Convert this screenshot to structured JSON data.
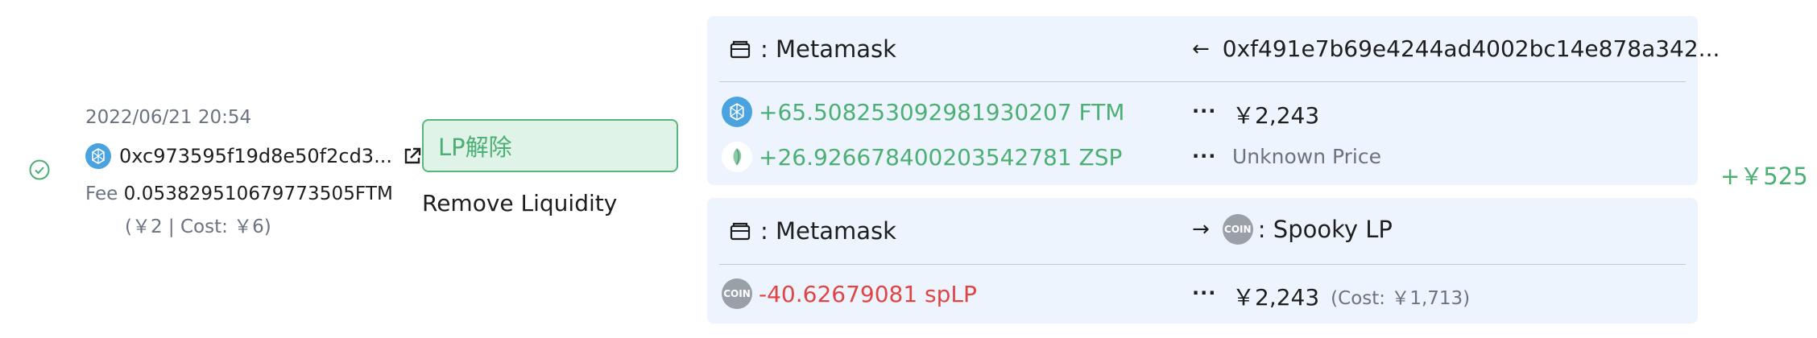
{
  "status": {
    "icon": "check-circle-icon"
  },
  "tx": {
    "date": "2022/06/21 20:54",
    "hash": "0xc973595f19d8e50f2cd3...",
    "fee_label": "Fee",
    "fee_value": "0.053829510679773505FTM",
    "fee_fiat": "(￥2 | Cost: ￥6)"
  },
  "action": {
    "badge": "LP解除",
    "label": "Remove Liquidity"
  },
  "transfers": [
    {
      "from_label": ": Metamask",
      "direction_arrow": "←",
      "counterparty": "0xf491e7b69e4244ad4002bc14e878a342...",
      "items": [
        {
          "amount": "+65.508253092981930207 FTM",
          "sign": "positive",
          "icon": "ftm-coin-icon",
          "dots": "···",
          "price": "￥2,243"
        },
        {
          "amount": "+26.926678400203542781 ZSP",
          "sign": "positive",
          "icon": "zsp-coin-icon",
          "dots": "···",
          "price": "Unknown Price"
        }
      ]
    },
    {
      "from_label": ": Metamask",
      "direction_arrow": "→",
      "counterparty_icon_text": "COIN",
      "counterparty": ": Spooky LP",
      "items": [
        {
          "amount": "-40.62679081 spLP",
          "sign": "negative",
          "icon": "generic-coin-icon",
          "icon_text": "COIN",
          "dots": "···",
          "price": "￥2,243",
          "cost": "(Cost: ￥1,713)"
        }
      ]
    }
  ],
  "total": "+￥525",
  "colors": {
    "positive": "#4caf74",
    "negative": "#e04545",
    "panel": "#eef4fd",
    "ftm": "#4aa3df"
  }
}
